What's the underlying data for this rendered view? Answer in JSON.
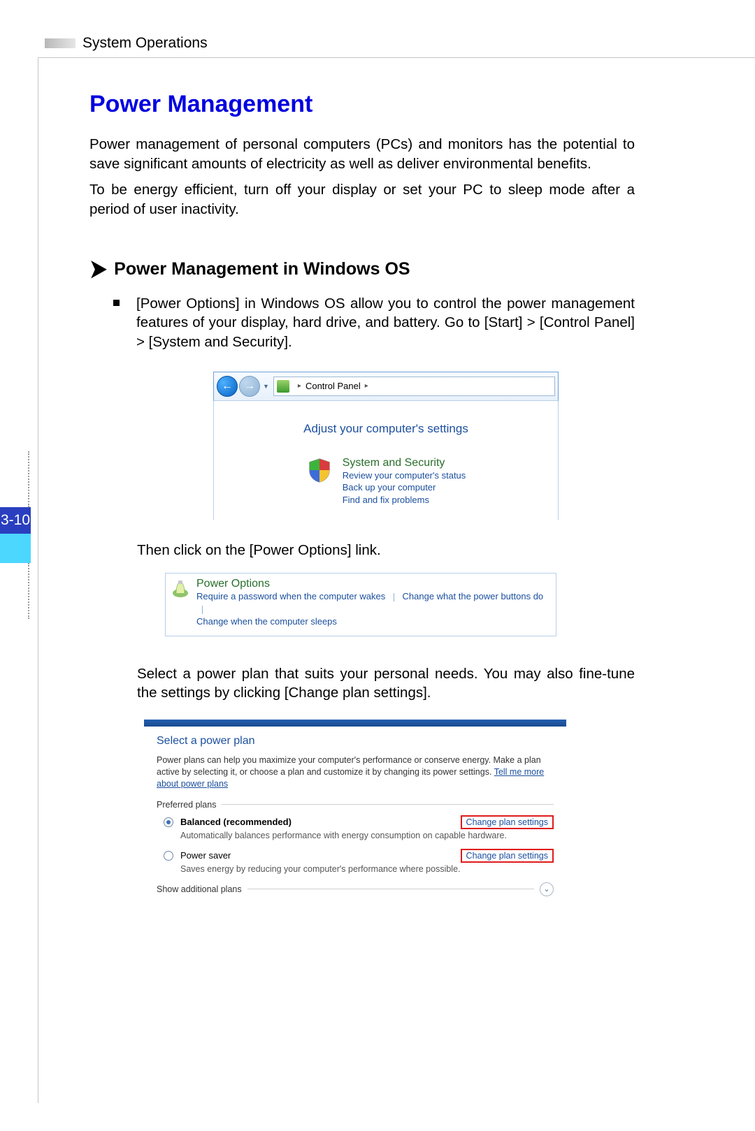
{
  "header": {
    "section": "System Operations"
  },
  "page_number": "3-10",
  "title": "Power Management",
  "intro": {
    "p1": "Power management of personal computers (PCs) and monitors has the potential to save significant amounts of electricity as well as deliver environmental benefits.",
    "p2": "To be energy efficient, turn off your display or set your PC to sleep mode after a period of user inactivity."
  },
  "sub": {
    "chevron": "➤",
    "title": "Power Management in Windows OS",
    "bullet": "[Power Options] in Windows OS allow you to control the power management features of your display, hard drive, and battery. Go to [Start] > [Control Panel] > [System and Security].",
    "then": "Then click on the [Power Options] link.",
    "select": "Select a power plan that suits your personal needs. You may also fine-tune the settings by clicking [Change plan settings]."
  },
  "shot1": {
    "back": "←",
    "fwd": "→",
    "drop": "▼",
    "tri": "▸",
    "breadcrumb": "Control Panel",
    "adjust": "Adjust your computer's settings",
    "ss_title": "System and Security",
    "ss_l1": "Review your computer's status",
    "ss_l2": "Back up your computer",
    "ss_l3": "Find and fix problems"
  },
  "shot2": {
    "title": "Power Options",
    "l1": "Require a password when the computer wakes",
    "l2": "Change what the power buttons do",
    "l3": "Change when the computer sleeps"
  },
  "shot3": {
    "h": "Select a power plan",
    "desc1": "Power plans can help you maximize your computer's performance or conserve energy. Make a plan active by selecting it, or choose a plan and customize it by changing its power settings. ",
    "desc_link": "Tell me more about power plans",
    "preferred": "Preferred plans",
    "plan1": {
      "name": "Balanced (recommended)",
      "sub": "Automatically balances performance with energy consumption on capable hardware.",
      "change": "Change plan settings"
    },
    "plan2": {
      "name": "Power saver",
      "sub": "Saves energy by reducing your computer's performance where possible.",
      "change": "Change plan settings"
    },
    "show": "Show additional plans",
    "chev": "⌄"
  }
}
